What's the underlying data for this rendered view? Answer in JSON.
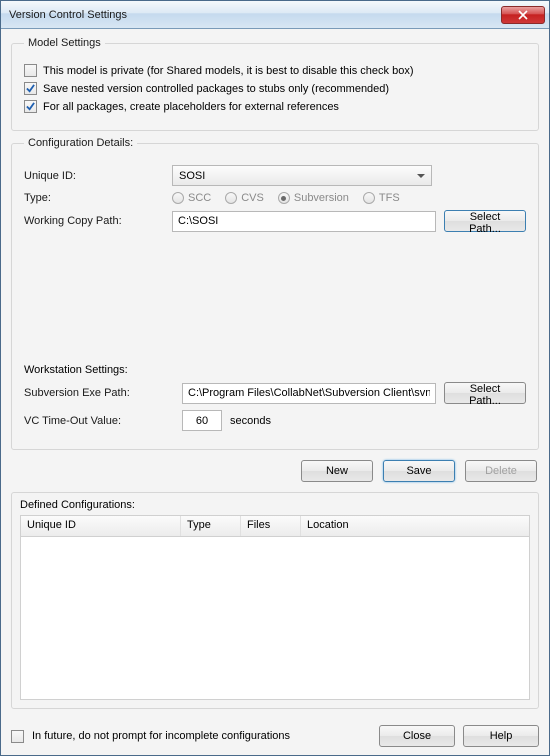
{
  "window": {
    "title": "Version Control Settings"
  },
  "modelSettings": {
    "legend": "Model Settings",
    "opt_private": "This model is private (for Shared models, it is best to disable this check box)",
    "opt_stubs": "Save nested version controlled packages to stubs only (recommended)",
    "opt_placeholders": "For all packages, create placeholders for external references"
  },
  "config": {
    "legend": "Configuration Details:",
    "uniqueIdLabel": "Unique ID:",
    "uniqueId": "SOSI",
    "typeLabel": "Type:",
    "types": {
      "scc": "SCC",
      "cvs": "CVS",
      "svn": "Subversion",
      "tfs": "TFS"
    },
    "workingCopyLabel": "Working Copy Path:",
    "workingCopy": "C:\\SOSI",
    "selectPathBtn": "Select Path..."
  },
  "workstation": {
    "legend": "Workstation Settings:",
    "exeLabel": "Subversion Exe Path:",
    "exePath": "C:\\Program Files\\CollabNet\\Subversion Client\\svn.e",
    "selectPathBtn": "Select Path...",
    "timeoutLabel": "VC Time-Out Value:",
    "timeoutValue": "60",
    "timeoutUnit": "seconds"
  },
  "buttons": {
    "new": "New",
    "save": "Save",
    "delete": "Delete",
    "close": "Close",
    "help": "Help"
  },
  "defined": {
    "label": "Defined Configurations:",
    "cols": {
      "uniqueId": "Unique ID",
      "type": "Type",
      "files": "Files",
      "location": "Location"
    }
  },
  "footer": {
    "noPrompt": "In future, do not prompt for incomplete configurations"
  }
}
